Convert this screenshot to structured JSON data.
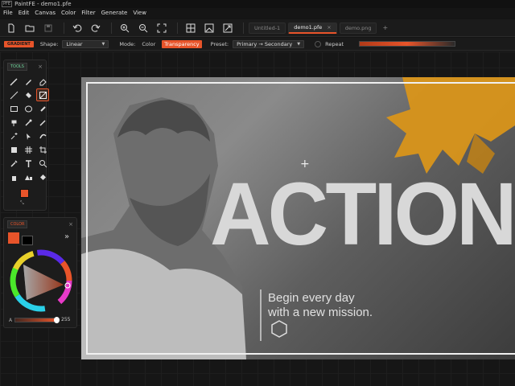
{
  "window": {
    "title": "PaintFE - demo1.pfe",
    "app_icon": "PFE"
  },
  "menu": [
    "File",
    "Edit",
    "Canvas",
    "Color",
    "Filter",
    "Generate",
    "View"
  ],
  "toolbar": {
    "buttons": [
      "new-file-icon",
      "open-folder-icon",
      "save-icon",
      "undo-icon",
      "redo-icon",
      "zoom-in-icon",
      "zoom-out-icon",
      "fit-screen-icon",
      "grid-icon",
      "image-icon",
      "resize-icon"
    ],
    "tabs": [
      {
        "label": "Untitled-1",
        "active": false,
        "closable": false
      },
      {
        "label": "demo1.pfe",
        "active": true,
        "closable": true,
        "close": "×"
      },
      {
        "label": "demo.png",
        "active": false,
        "closable": false
      }
    ],
    "add_tab": "+"
  },
  "options": {
    "tool_badge": "GRADIENT",
    "shape_label": "Shape:",
    "shape_value": "Linear",
    "mode_label": "Mode:",
    "mode_color": "Color",
    "mode_transparency": "Transparency",
    "preset_label": "Preset:",
    "preset_value": "Primary → Secondary",
    "repeat_label": "Repeat"
  },
  "tools_panel": {
    "title": "TOOLS",
    "close": "×",
    "icons": [
      "brush-icon",
      "pencil-icon",
      "eraser-icon",
      "line-icon",
      "fill-bucket-icon",
      "gradient-icon",
      "rectangle-icon",
      "ellipse-icon",
      "link-icon",
      "clone-stamp-icon",
      "magic-wand-icon",
      "color-picker-icon",
      "wand-icon",
      "move-selection-icon",
      "warp-icon",
      "transform-icon",
      "mesh-icon",
      "crop-icon",
      "eyedropper-icon",
      "text-icon",
      "zoom-icon",
      "hand-icon",
      "shapes-icon",
      "layers-icon"
    ]
  },
  "color_panel": {
    "title": "COLOR",
    "close": "×",
    "expand": "»",
    "alpha_label": "A",
    "alpha_value": "255"
  },
  "colors": {
    "primary": "#e8542a",
    "secondary": "#000000",
    "accent": "#e8542a"
  },
  "artwork": {
    "headline": "ACTION",
    "subline1": "Begin every day",
    "subline2": "with a new mission."
  }
}
